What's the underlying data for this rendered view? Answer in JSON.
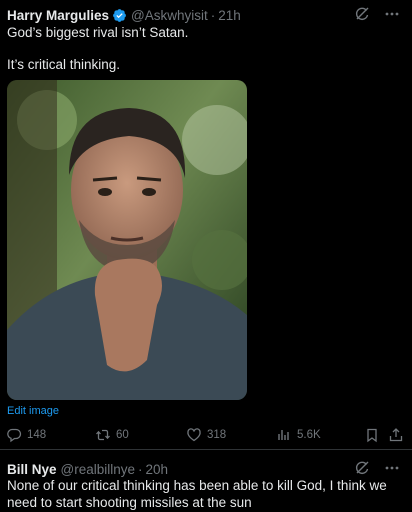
{
  "tweet1": {
    "author_name": "Harry Margulies",
    "handle": "@Askwhyisit",
    "separator": "·",
    "time": "21h",
    "line1": "God’s biggest rival isn’t Satan.",
    "line2": "It’s critical thinking.",
    "edit_image_label": "Edit image",
    "replies": "148",
    "retweets": "60",
    "likes": "318",
    "views": "5.6K"
  },
  "tweet2": {
    "author_name": "Bill Nye",
    "handle": "@realbillnye",
    "separator": "·",
    "time": "20h",
    "text": "None of our critical thinking has been able to kill God, I think we need to start shooting missiles at the sun"
  },
  "icons": {
    "verified": "verified-badge-icon",
    "grok": "grok-icon",
    "more": "more-icon",
    "reply": "reply-icon",
    "retweet": "retweet-icon",
    "like": "heart-icon",
    "views": "views-icon",
    "bookmark": "bookmark-icon",
    "share": "share-icon"
  },
  "colors": {
    "background": "#000000",
    "text": "#e7e9ea",
    "secondary": "#71767b",
    "accent": "#1d9bf0"
  }
}
